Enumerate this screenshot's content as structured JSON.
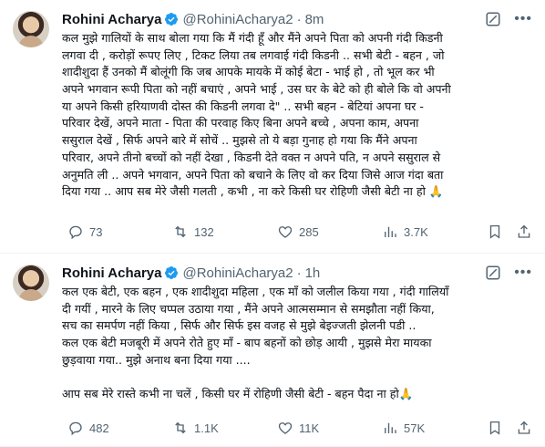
{
  "tweets": [
    {
      "name": "Rohini Acharya",
      "handle": "@RohiniAcharya2",
      "dot": "·",
      "time": "8m",
      "lines": [
        "कल मुझे गालियों के साथ बोला गया कि मैं गंदी हूँ और मैंने अपने  पिता को अपनी गंदी किडनी",
        "लगवा दी , करोड़ों रूपए लिए , टिकट लिया तब लगवाई गंदी किडनी .. सभी बेटी - बहन , जो",
        "शादीशुदा हैं उनको मैं बोलूंगी कि जब आपके मायके में कोई बेटा - भाई हो , तो भूल कर भी",
        "अपने भगवान रूपी पिता को नहीं बचाएं , अपने भाई , उस घर के बेटे को ही बोले कि वो अपनी",
        "या अपने किसी हरियाणवी  दोस्त की किडनी लगवा दे\" .. सभी बहन - बेटियां अपना घर -",
        "परिवार देखें, अपने माता - पिता की परवाह किए बिना अपने बच्चे , अपना काम, अपना",
        "ससुराल देखें , सिर्फ अपने बारे में सोचें ..  मुझसे तो ये बड़ा गुनाह हो गया कि मैंने अपना",
        "परिवार, अपने तीनो बच्चों को नहीं देखा , किडनी देते वक्त न अपने पति, न अपने ससुराल से",
        "अनुमति ली .. अपने भगवान, अपने पिता को बचाने के लिए वो कर दिया जिसे आज गंदा बता",
        "दिया गया .. आप सब मेरे जैसी गलती , कभी , ना करे किसी घर रोहिणी जैसी बेटी ना हो 🙏"
      ],
      "replies": "73",
      "retweets": "132",
      "likes": "285",
      "views": "3.7K"
    },
    {
      "name": "Rohini Acharya",
      "handle": "@RohiniAcharya2",
      "dot": "·",
      "time": "1h",
      "lines": [
        "कल एक बेटी, एक बहन , एक शादीशुदा महिला , एक माँ को जलील किया गया , गंदी गालियाँ",
        "दी गयीं , मारने के लिए चप्पल उठाया गया , मैंने  अपने आत्मसम्मान से समझौता नहीं किया,",
        "सच का समर्पण नहीं किया , सिर्फ और सिर्फ इस वजह से मुझे बेइज्जती झेलनी पडी ..",
        "कल एक बेटी मजबूरी में अपने रोते हुए माँ - बाप बहनों को छोड़  आयी , मुझसे मेरा मायका",
        "छुड़वाया गया.. मुझे अनाथ बना दिया गया ....",
        "",
        "आप सब मेरे रास्ते कभी ना चलें , किसी घर में रोहिणी जैसी बेटी - बहन  पैदा ना  हो🙏"
      ],
      "replies": "482",
      "retweets": "1.1K",
      "likes": "11K",
      "views": "57K"
    }
  ],
  "icons": {
    "verified": "verified-badge-icon",
    "grok": "grok-icon",
    "more": "more-icon",
    "reply": "reply-icon",
    "retweet": "retweet-icon",
    "like": "heart-icon",
    "views": "views-icon",
    "bookmark": "bookmark-icon",
    "share": "share-icon"
  },
  "colors": {
    "verified": "#1d9bf0",
    "muted": "#536471",
    "text": "#0f1419"
  }
}
